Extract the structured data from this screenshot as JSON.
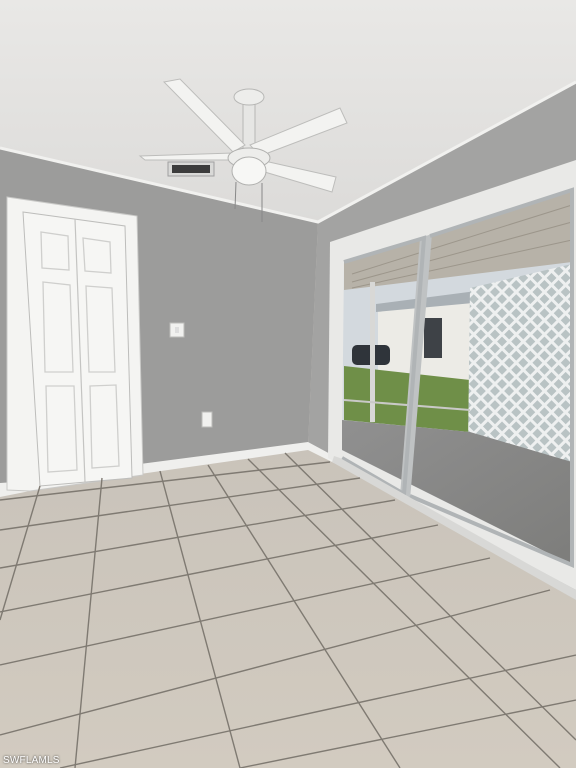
{
  "watermark": {
    "text": "SWFLAMLS"
  },
  "colors": {
    "ceiling": "#e6e5e3",
    "wall": "#9e9e9d",
    "wall_right": "#a4a4a3",
    "floor": "#cdc6bb",
    "grout": "#7c776f",
    "trim": "#f3f3f1",
    "door": "#f5f5f3",
    "glass_frame": "#b8bcbe",
    "patio_floor": "#8b8b89",
    "grass": "#6f8f48",
    "sky": "#d6dde3",
    "lattice": "#ecedee"
  },
  "icons": {
    "ceiling_fan": "ceiling-fan-icon",
    "air_vent": "air-vent-icon",
    "light_switch": "light-switch-icon",
    "outlet": "outlet-icon"
  }
}
